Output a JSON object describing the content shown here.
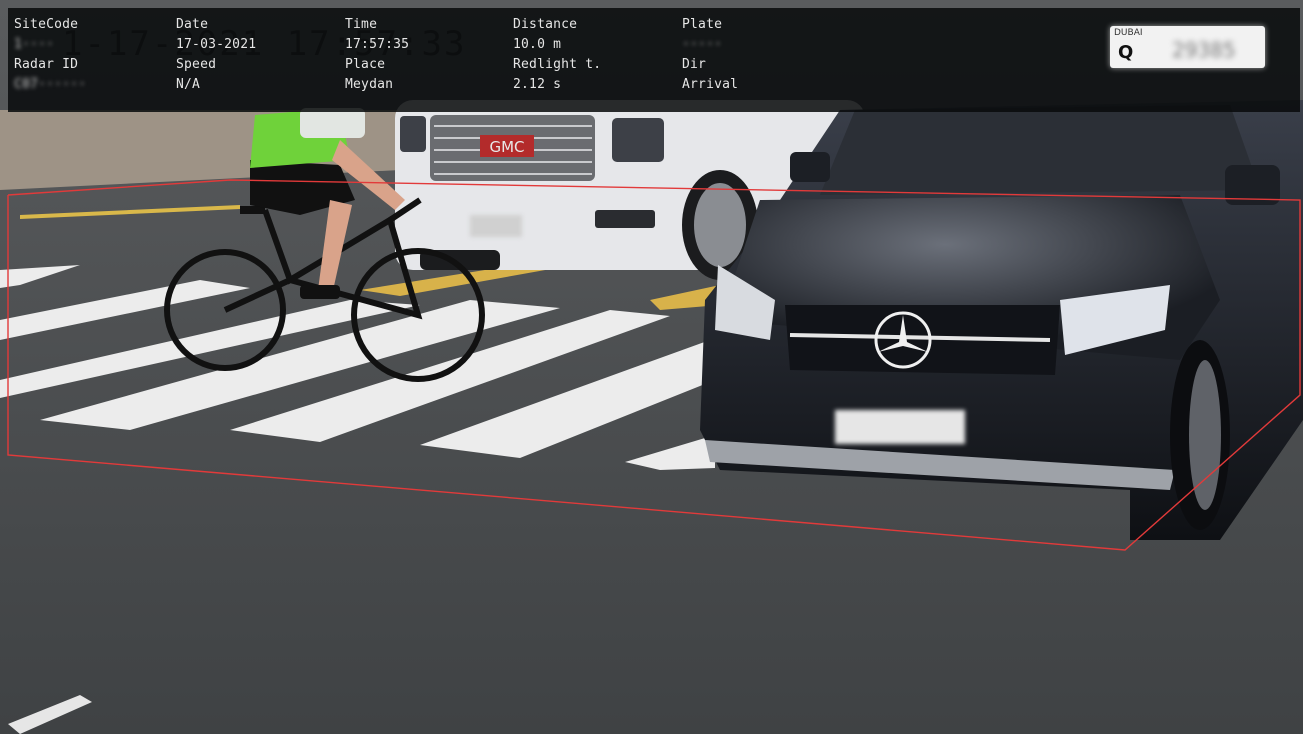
{
  "overlay": {
    "fields": [
      {
        "label": "SiteCode",
        "value": "1····",
        "blurred": true
      },
      {
        "label": "Date",
        "value": "17-03-2021",
        "blurred": false
      },
      {
        "label": "Time",
        "value": "17:57:35",
        "blurred": false
      },
      {
        "label": "Distance",
        "value": "10.0 m",
        "blurred": false
      },
      {
        "label": "Plate",
        "value": "·····",
        "blurred": true
      },
      {
        "label": "Radar ID",
        "value": "C07······",
        "blurred": true
      },
      {
        "label": "Speed",
        "value": "N/A",
        "blurred": false
      },
      {
        "label": "Place",
        "value": "Meydan",
        "blurred": false
      },
      {
        "label": "Redlight t.",
        "value": "2.12 s",
        "blurred": false
      },
      {
        "label": "Dir",
        "value": "Arrival",
        "blurred": false
      }
    ],
    "ghost_stamp": "1-17-2021  17:57:33"
  },
  "plate_crop": {
    "emirate": "DUBAI",
    "letter": "Q",
    "number": "29385"
  },
  "scene": {
    "front_car_brand": "Mercedes-Benz",
    "rear_car_brand": "GMC",
    "front_plate": {
      "emirate": "DUBAI",
      "letter": "Q",
      "number": "29385"
    }
  },
  "colors": {
    "detection_box": "#e23a3a",
    "overlay_bg": "#0a0c0e",
    "road": "#4c4f52",
    "crosswalk": "#eaeaea",
    "cyclist_jersey": "#6fd23a"
  }
}
